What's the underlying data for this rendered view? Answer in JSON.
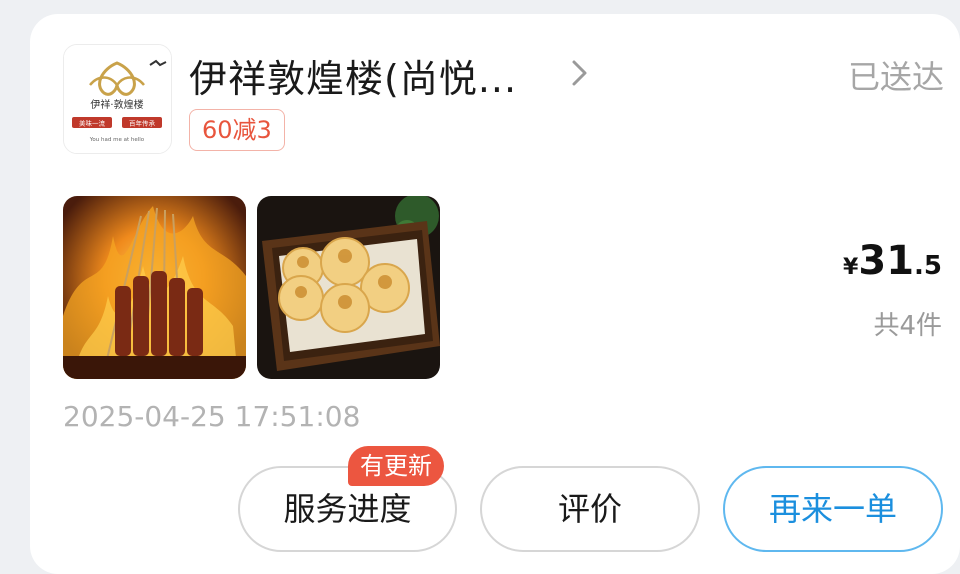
{
  "order": {
    "store_name": "伊祥敦煌楼(尚悦...",
    "status": "已送达",
    "promo_tag": "60减3",
    "logo": {
      "brand_text": "伊祥·敦煌楼",
      "tag_left": "美味一流",
      "tag_right": "百年传承",
      "slogan": "You had me at hello"
    },
    "price": {
      "currency": "¥",
      "integer": "31",
      "decimal": ".5"
    },
    "item_count": "共4件",
    "datetime": "2025-04-25 17:51:08",
    "items": [
      {
        "name": "grilled-skewers-photo"
      },
      {
        "name": "pan-fried-buns-photo"
      }
    ]
  },
  "actions": {
    "progress_label": "服务进度",
    "progress_badge": "有更新",
    "review_label": "评价",
    "reorder_label": "再来一单"
  },
  "colors": {
    "accent_blue": "#1b8fde",
    "promo_red": "#e8553d",
    "badge_red": "#ec5640"
  }
}
